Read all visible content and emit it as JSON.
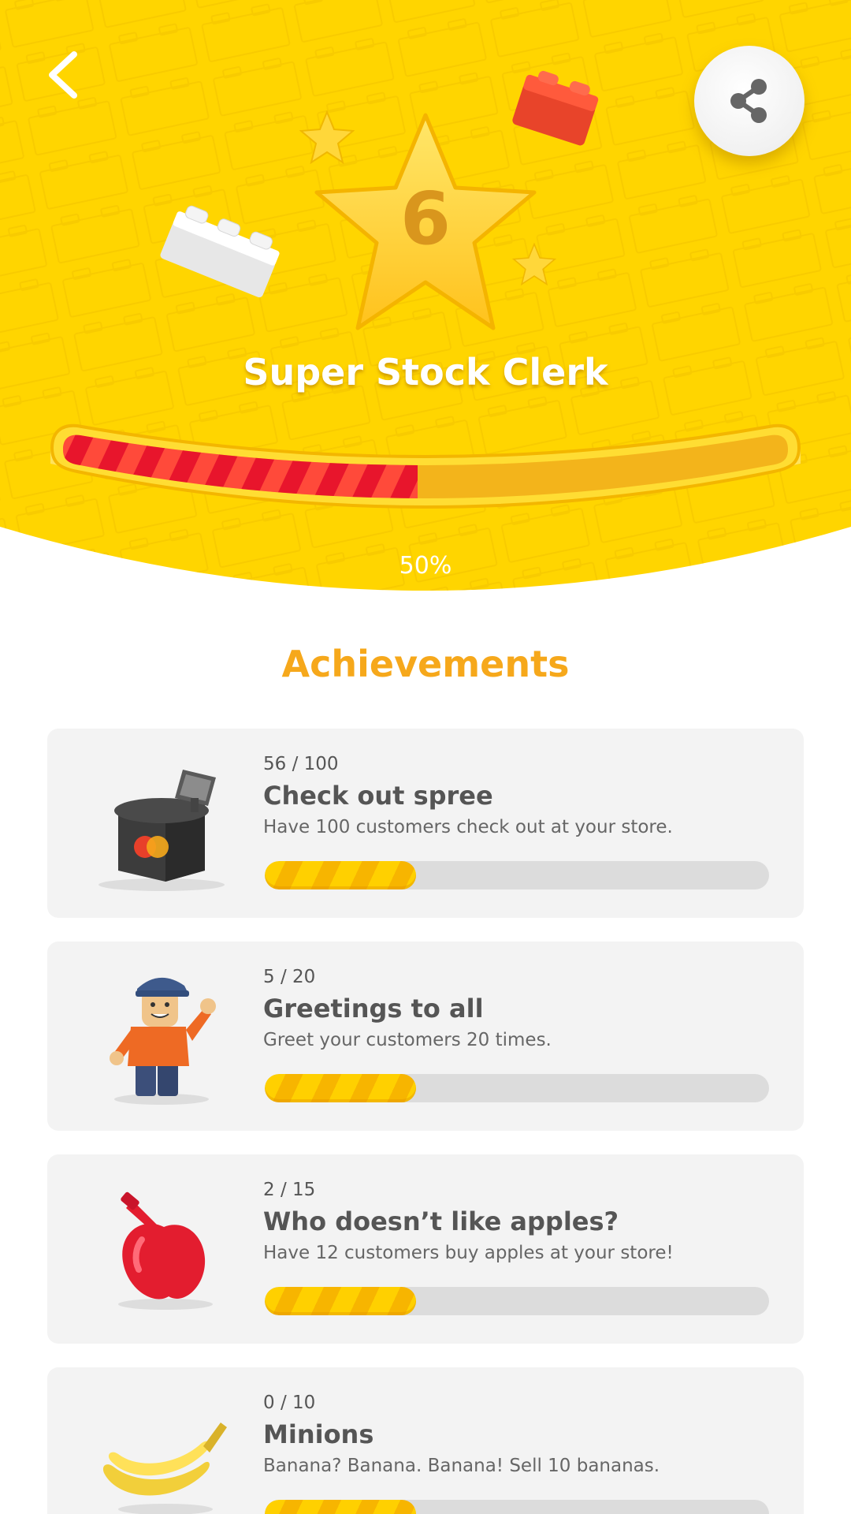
{
  "colors": {
    "header_yellow": "#FFD500",
    "accent_orange": "#F6A81B",
    "progress_red": "#E8152C",
    "progress_yellow": "#FFD000",
    "card_bg": "#F3F3F3"
  },
  "header": {
    "back_icon": "chevron-left-icon",
    "share_icon": "share-icon",
    "level": "6",
    "title": "Super Stock Clerk",
    "progress_percent_label": "50%",
    "progress_fraction": 0.5
  },
  "achievements": {
    "title": "Achievements",
    "items": [
      {
        "progress_text": "56 / 100",
        "title": "Check out spree",
        "description": "Have 100 customers check out at your store.",
        "icon": "cash-register-icon",
        "bar_fraction": 0.3
      },
      {
        "progress_text": "5 / 20",
        "title": "Greetings to all",
        "description": "Greet your customers 20 times.",
        "icon": "shopkeeper-figure-icon",
        "bar_fraction": 0.3
      },
      {
        "progress_text": "2 / 15",
        "title": "Who doesn’t like apples?",
        "description": "Have 12 customers buy apples at your store!",
        "icon": "apple-icon",
        "bar_fraction": 0.3
      },
      {
        "progress_text": "0 / 10",
        "title": "Minions",
        "description": "Banana? Banana. Banana! Sell 10 bananas.",
        "icon": "banana-icon",
        "bar_fraction": 0.3
      }
    ]
  }
}
